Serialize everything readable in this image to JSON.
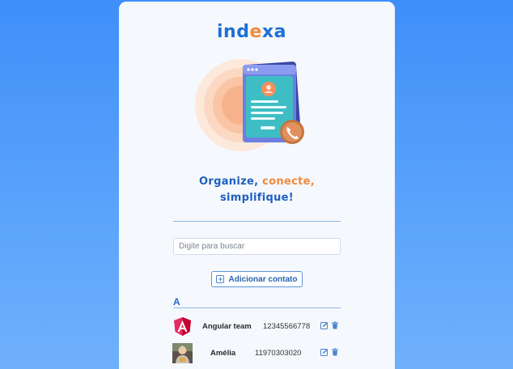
{
  "app": {
    "logo": {
      "prefix": "ind",
      "middle": "e",
      "suffix": "xa"
    },
    "tagline": {
      "word1": "Organize,",
      "word2": "conecte,",
      "word3": "simplifique!"
    }
  },
  "search": {
    "placeholder": "Digite para buscar",
    "value": ""
  },
  "add_button": {
    "label": "Adicionar contato",
    "icon": "plus-square-icon"
  },
  "sections": [
    {
      "letter": "A",
      "contacts": [
        {
          "name": "Angular team",
          "phone": "12345566778",
          "avatar": "angular-logo"
        },
        {
          "name": "Amélia",
          "phone": "11970303020",
          "avatar": "photo"
        }
      ]
    }
  ],
  "colors": {
    "accent_blue": "#1f6fd6",
    "accent_orange": "#f08a3a",
    "background": "#4593fa",
    "card": "#f5f8fc"
  }
}
